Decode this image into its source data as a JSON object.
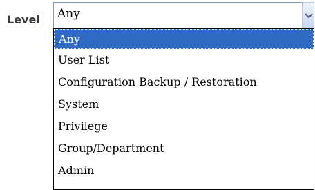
{
  "filter": {
    "label": "Level",
    "selected_value": "Any",
    "options": [
      "Any",
      "User List",
      "Configuration Backup / Restoration",
      "System",
      "Privilege",
      "Group/Department",
      "Admin"
    ],
    "highlighted_index": 0,
    "highlight_color": "#316ac5"
  }
}
